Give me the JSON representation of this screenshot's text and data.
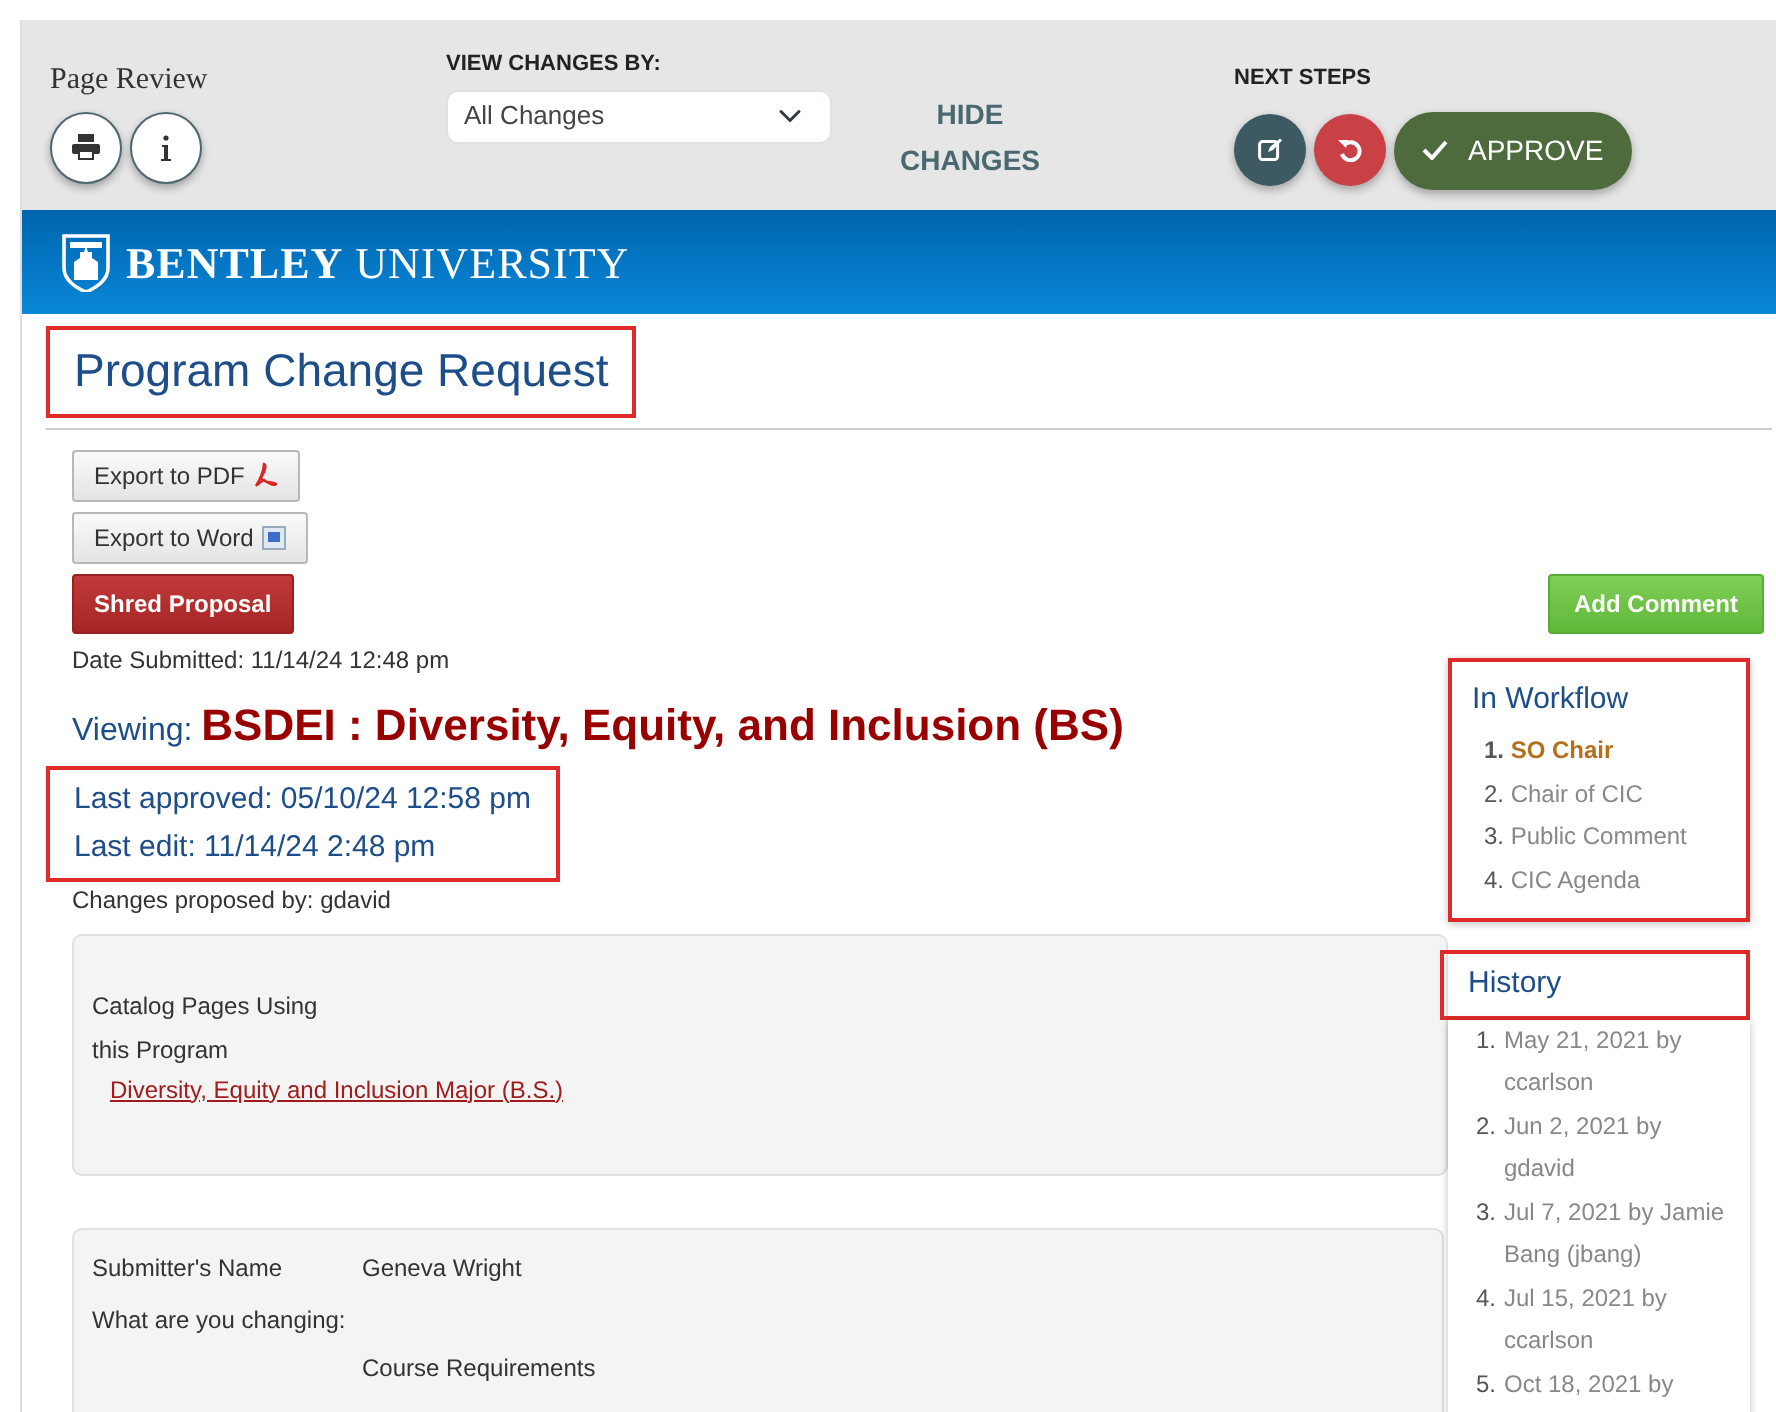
{
  "toolbar": {
    "title": "Page Review",
    "view_label": "VIEW CHANGES BY:",
    "view_value": "All Changes",
    "hide_changes": "HIDE CHANGES",
    "next_steps_label": "NEXT STEPS",
    "approve": "APPROVE"
  },
  "banner": {
    "brand_bold": "BENTLEY",
    "brand_light": "UNIVERSITY"
  },
  "page_title": {
    "text": "Program Change Request",
    "highlighted": true
  },
  "exports": [
    {
      "label": "Export to PDF",
      "kind": "pdf"
    },
    {
      "label": "Export to Word",
      "kind": "word"
    }
  ],
  "shred": "Shred Proposal",
  "add_comment": "Add Comment",
  "date_submitted": "Date Submitted: 11/14/24 12:48 pm",
  "viewing": {
    "label": "Viewing:",
    "value": "BSDEI : Diversity, Equity, and Inclusion (BS)"
  },
  "last_info": {
    "highlighted": true,
    "lines": [
      "Last approved: 05/10/24 12:58 pm",
      "Last edit: 11/14/24 2:48 pm"
    ]
  },
  "changes_by": "Changes proposed by: gdavid",
  "catalog": {
    "label_lines": [
      "Catalog Pages Using",
      "this Program"
    ],
    "link": "Diversity, Equity and Inclusion Major (B.S.)"
  },
  "fields": [
    {
      "label": "Submitter's Name",
      "value": "Geneva Wright",
      "kind": "inline"
    },
    {
      "label": "What are you changing:",
      "value": "Course Requirements",
      "kind": "below"
    }
  ],
  "workflow": {
    "title": "In Workflow",
    "highlighted": true,
    "steps": [
      {
        "number": "1.",
        "label": "SO Chair",
        "current": true
      },
      {
        "number": "2.",
        "label": "Chair of CIC",
        "current": false
      },
      {
        "number": "3.",
        "label": "Public Comment",
        "current": false
      },
      {
        "number": "4.",
        "label": "CIC Agenda",
        "current": false
      }
    ]
  },
  "history": {
    "title": "History",
    "highlighted": true,
    "entries": [
      {
        "number": "1.",
        "text": "May 21, 2021 by ccarlson"
      },
      {
        "number": "2.",
        "text": "Jun 2, 2021 by gdavid"
      },
      {
        "number": "3.",
        "text": "Jul 7, 2021 by Jamie Bang (jbang)"
      },
      {
        "number": "4.",
        "text": "Jul 15, 2021 by ccarlson"
      },
      {
        "number": "5.",
        "text": "Oct 18, 2021 by"
      }
    ]
  }
}
